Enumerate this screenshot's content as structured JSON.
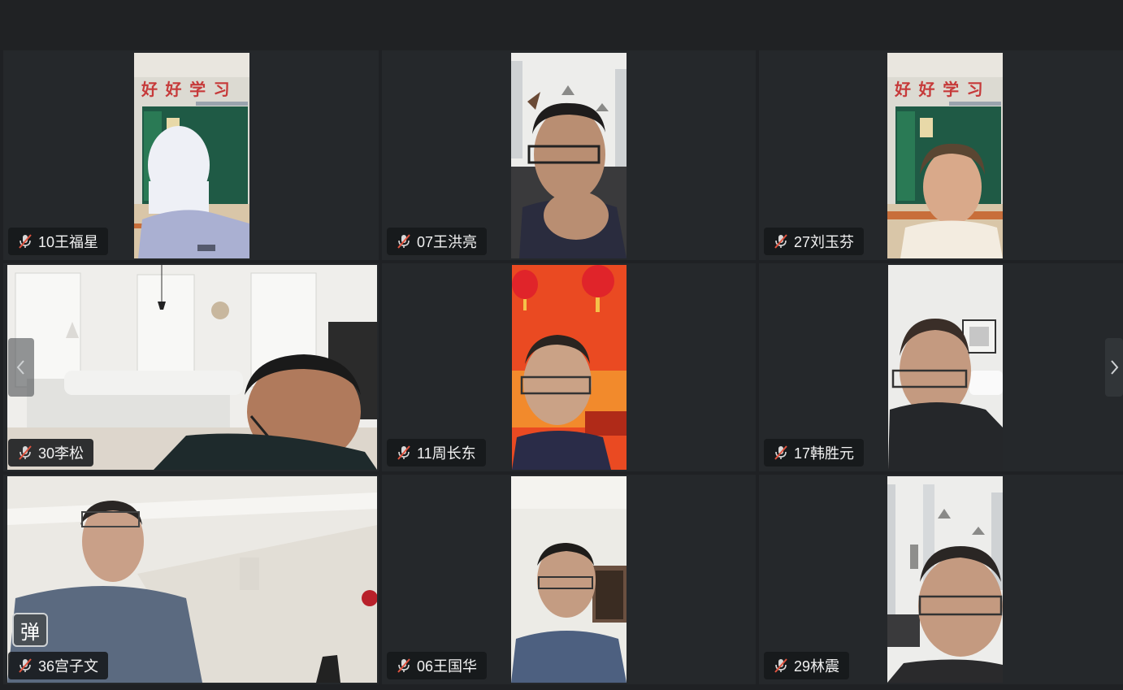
{
  "participants": [
    {
      "name": "10王福星"
    },
    {
      "name": "07王洪亮"
    },
    {
      "name": "27刘玉芬"
    },
    {
      "name": "30李松"
    },
    {
      "name": "11周长东"
    },
    {
      "name": "17韩胜元"
    },
    {
      "name": "36宫子文"
    },
    {
      "name": "06王国华"
    },
    {
      "name": "29林震"
    }
  ],
  "classroom_banner": "好 好 学 习",
  "danmu_label": "弹",
  "icons": {
    "mute": "mic-muted-icon",
    "prev": "chevron-left-icon",
    "next": "chevron-right-icon"
  },
  "colors": {
    "tile_bg": "#25282b",
    "page_bg": "#1f2124",
    "mute_red": "#e0533f"
  }
}
